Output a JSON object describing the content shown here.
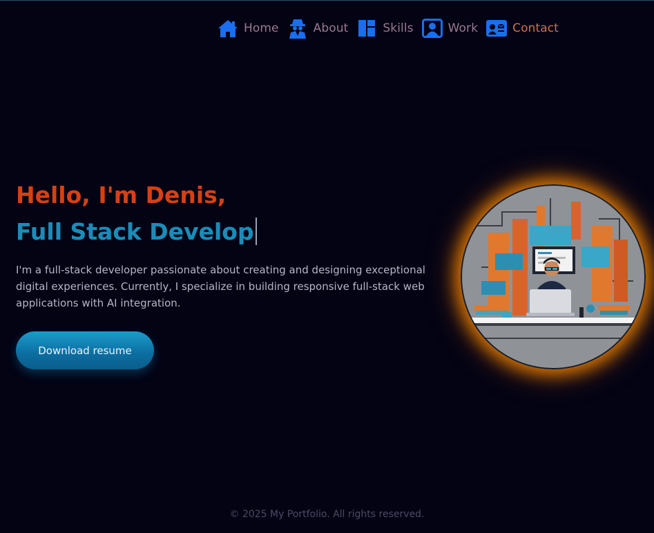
{
  "nav": {
    "items": [
      {
        "label": "Home",
        "icon": "home-icon"
      },
      {
        "label": "About",
        "icon": "spy-icon"
      },
      {
        "label": "Skills",
        "icon": "dashboard-icon"
      },
      {
        "label": "Work",
        "icon": "portrait-icon"
      },
      {
        "label": "Contact",
        "icon": "id-card-icon"
      }
    ]
  },
  "hero": {
    "greeting": "Hello, I'm Denis,",
    "role": "Full Stack Develop",
    "bio": "I'm a full-stack developer passionate about creating and designing exceptional digital experiences. Currently, I specialize in building responsive full-stack web applications with AI integration.",
    "resume_button": "Download resume"
  },
  "footer": {
    "text": "© 2025 My Portfolio. All rights reserved."
  },
  "colors": {
    "background": "#030314",
    "accent_orange": "#d64012",
    "accent_blue": "#1a8cb8",
    "icon_blue": "#1a6ef0",
    "glow": "#ff8c00"
  }
}
